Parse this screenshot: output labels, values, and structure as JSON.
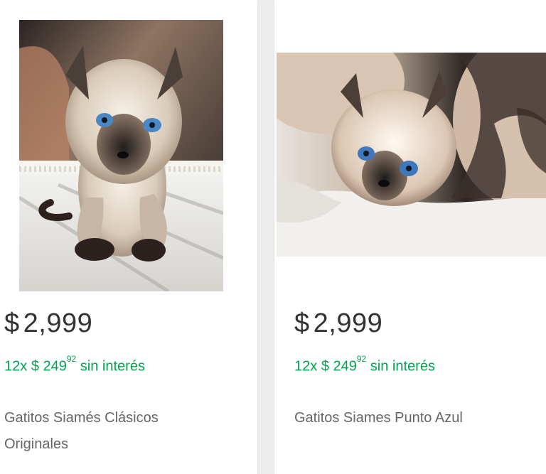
{
  "listings": [
    {
      "currency": "$",
      "price": "2,999",
      "installments": {
        "count": "12x",
        "currency": "$",
        "amount": "249",
        "cents": "92",
        "suffix": "sin interés"
      },
      "title": "Gatitos Siamés Clásicos Originales",
      "image": {
        "name": "siamese-kitten-photo"
      }
    },
    {
      "currency": "$",
      "price": "2,999",
      "installments": {
        "count": "12x",
        "currency": "$",
        "amount": "249",
        "cents": "92",
        "suffix": "sin interés"
      },
      "title": "Gatitos Siames Punto Azul",
      "image": {
        "name": "siamese-kitten-photo"
      }
    }
  ],
  "colors": {
    "price": "#333333",
    "installments": "#00a650",
    "title": "#666666",
    "card_background": "#ffffff",
    "page_background": "#ededed"
  }
}
